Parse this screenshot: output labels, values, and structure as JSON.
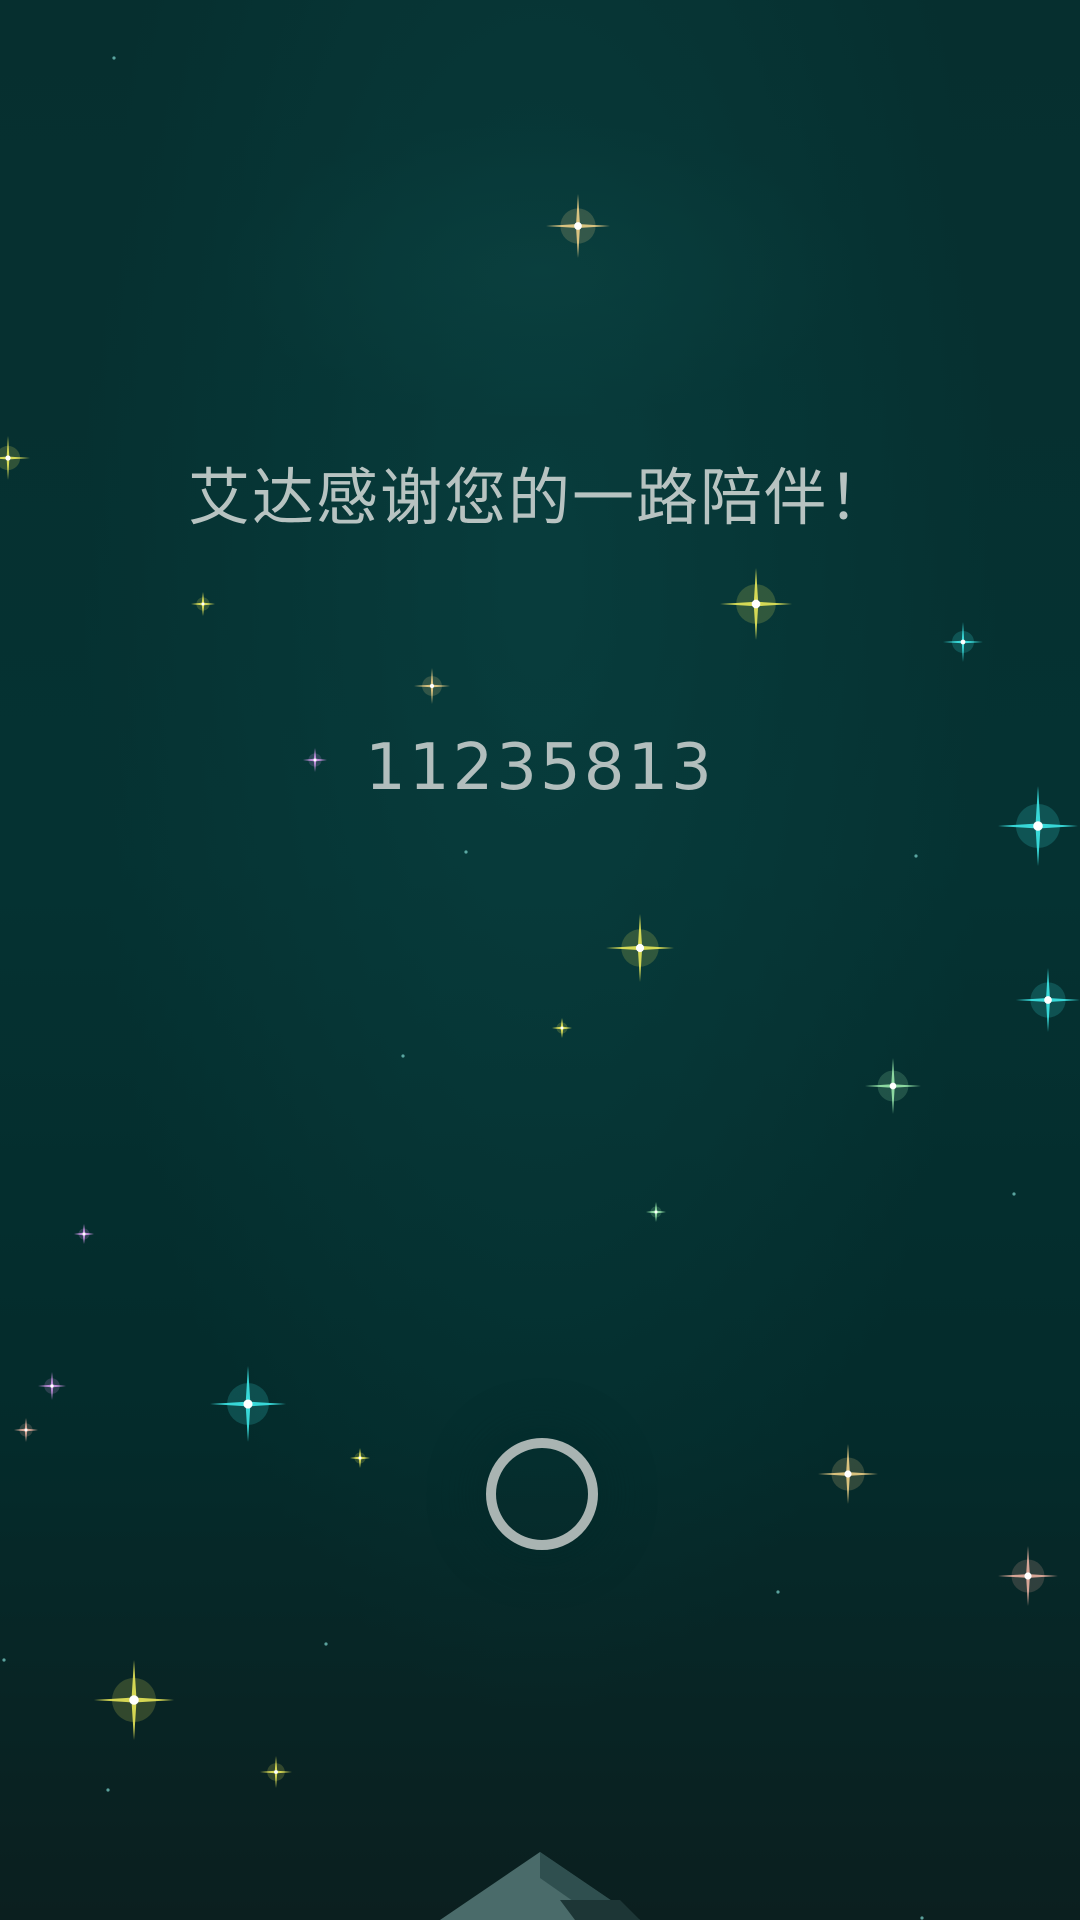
{
  "screen": {
    "thanks_message": "艾达感谢您的一路陪伴！",
    "code": "11235813"
  },
  "controls": {
    "ring_button_icon": "circle-ring-icon"
  },
  "colors": {
    "background": "#053232",
    "text": "#b7c3c1",
    "ring": "#a9b4b2",
    "star_gold": "#f7d68a",
    "star_yellow": "#f2f05a",
    "star_cyan": "#3ff0f0",
    "star_green": "#9ff0b0",
    "star_violet": "#d79af0",
    "star_pink": "#f5b7a6"
  }
}
